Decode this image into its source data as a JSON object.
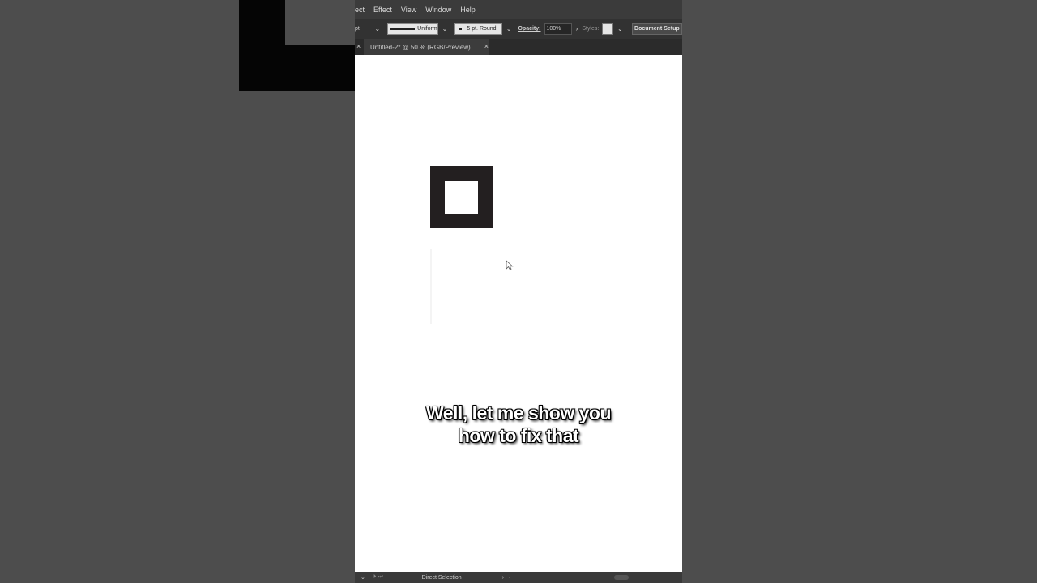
{
  "menubar": {
    "items": [
      "ect",
      "Effect",
      "View",
      "Window",
      "Help"
    ]
  },
  "controlbar": {
    "weight_unit": "pt",
    "stroke_profile": "Uniform",
    "brush": "5 pt. Round",
    "opacity_label": "Opacity:",
    "opacity_value": "100%",
    "styles_label": "Styles:",
    "document_setup": "Document Setup"
  },
  "tabbar": {
    "doc_title": "Untitled-2* @ 50 % (RGB/Preview)",
    "close_glyph": "×",
    "left_glyph": "×"
  },
  "caption": {
    "line1": "Well, let me show you",
    "line2": "how to fix that"
  },
  "statusbar": {
    "tool": "Direct Selection"
  },
  "colors": {
    "shape_fill": "#231f20",
    "ui_dark": "#323232",
    "background": "#4d4d4d"
  }
}
